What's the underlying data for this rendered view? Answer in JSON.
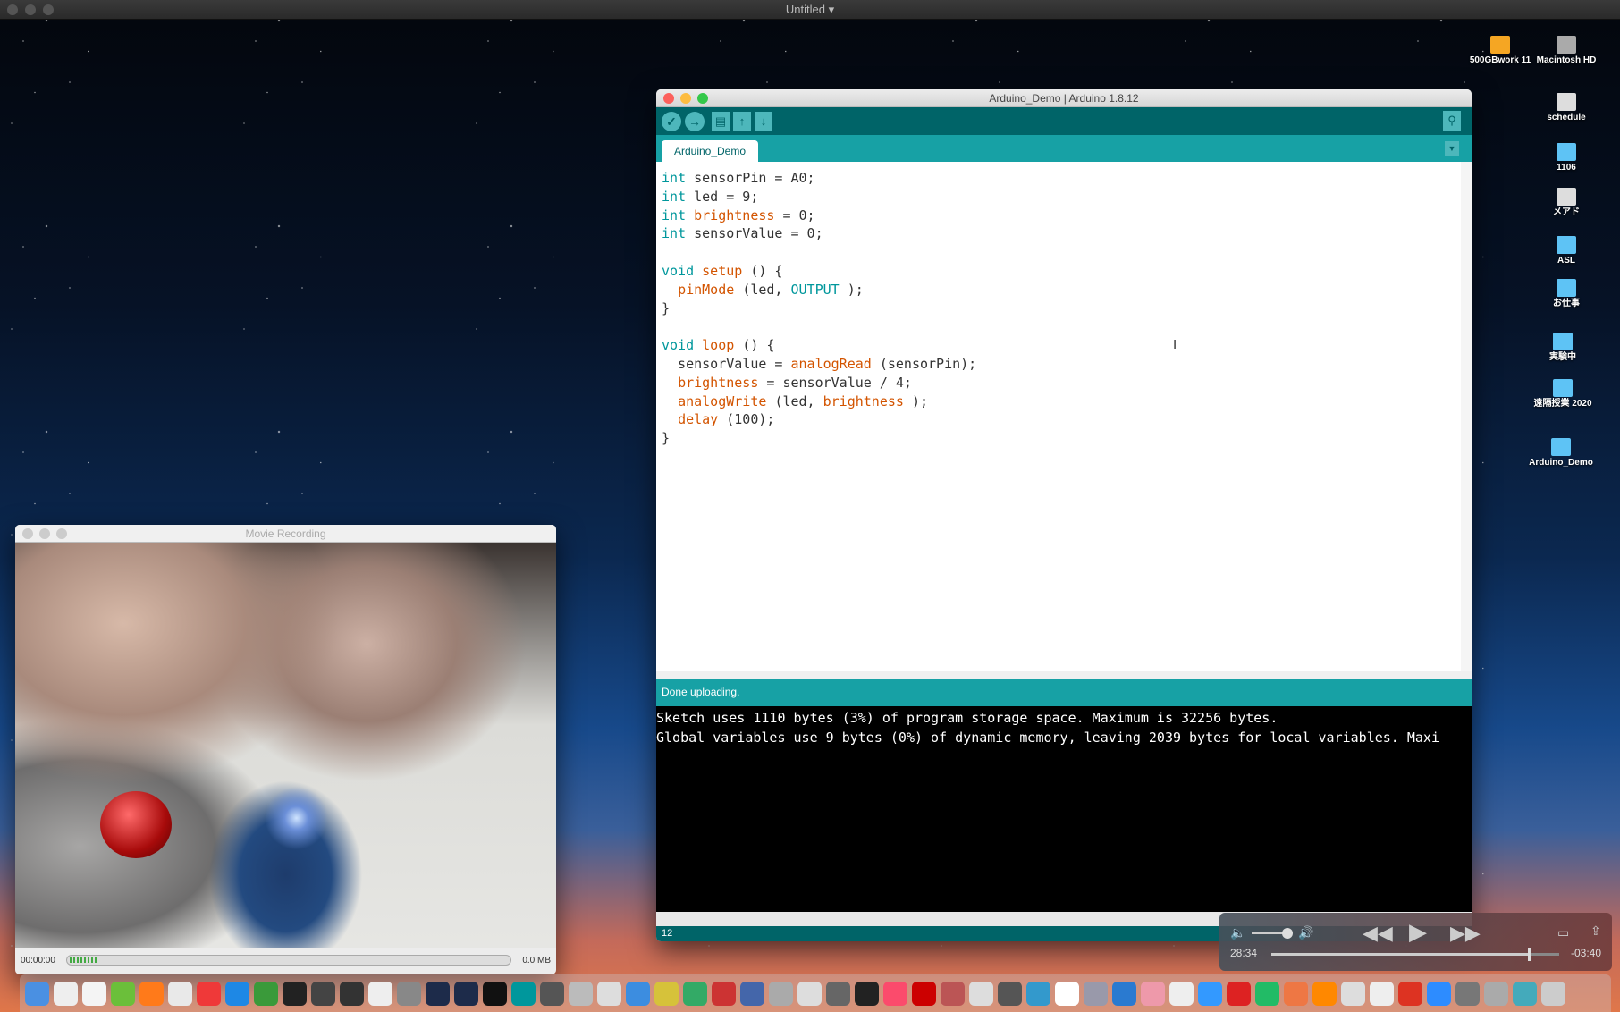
{
  "menubar": {
    "title": "Untitled"
  },
  "arduino": {
    "title": "Arduino_Demo | Arduino 1.8.12",
    "tab": "Arduino_Demo",
    "status": "Done uploading.",
    "line_number": "12",
    "code": [
      [
        [
          "kw",
          "int"
        ],
        [
          "",
          "sensorPin = A0;"
        ]
      ],
      [
        [
          "kw",
          "int"
        ],
        [
          "",
          "led = 9;"
        ]
      ],
      [
        [
          "kw",
          "int"
        ],
        [
          "fn",
          "brightness"
        ],
        [
          "",
          "= 0;"
        ]
      ],
      [
        [
          "kw",
          "int"
        ],
        [
          "",
          "sensorValue = 0;"
        ]
      ],
      [],
      [
        [
          "kw",
          "void"
        ],
        [
          "fn",
          "setup"
        ],
        [
          "",
          "() {"
        ]
      ],
      [
        [
          "",
          "  "
        ],
        [
          "fn",
          "pinMode"
        ],
        [
          "",
          "(led, "
        ],
        [
          "kw",
          "OUTPUT"
        ],
        [
          "",
          ");"
        ]
      ],
      [
        [
          "",
          "}"
        ]
      ],
      [],
      [
        [
          "kw",
          "void"
        ],
        [
          "fn",
          "loop"
        ],
        [
          "",
          "() {"
        ]
      ],
      [
        [
          "",
          "  sensorValue = "
        ],
        [
          "fn",
          "analogRead"
        ],
        [
          "",
          "(sensorPin);"
        ]
      ],
      [
        [
          "",
          "  "
        ],
        [
          "fn",
          "brightness"
        ],
        [
          "",
          "= sensorValue / 4;"
        ]
      ],
      [
        [
          "",
          "  "
        ],
        [
          "fn",
          "analogWrite"
        ],
        [
          "",
          "(led, "
        ],
        [
          "fn",
          "brightness"
        ],
        [
          "",
          ");"
        ]
      ],
      [
        [
          "",
          "  "
        ],
        [
          "fn",
          "delay"
        ],
        [
          "",
          "(100);"
        ]
      ],
      [
        [
          "",
          "}"
        ]
      ]
    ],
    "console": [
      "Sketch uses 1110 bytes (3%) of program storage space. Maximum is 32256 bytes.",
      "Global variables use 9 bytes (0%) of dynamic memory, leaving 2039 bytes for local variables. Maxi"
    ]
  },
  "movie": {
    "title": "Movie Recording",
    "time": "00:00:00",
    "size": "0.0 MB"
  },
  "player": {
    "elapsed": "28:34",
    "remaining": "-03:40",
    "progress": 0.89,
    "volume": 0.8
  },
  "desktop": {
    "icons": [
      {
        "label": "500GBwork 11",
        "color": "#f5a623"
      },
      {
        "label": "Macintosh HD",
        "color": "#aaa"
      },
      {
        "label": "schedule",
        "color": "#ddd"
      },
      {
        "label": "1106",
        "color": "#5ec3f5"
      },
      {
        "label": "メアド",
        "color": "#ddd"
      },
      {
        "label": "ASL",
        "color": "#5ec3f5"
      },
      {
        "label": "お仕事",
        "color": "#5ec3f5"
      },
      {
        "label": "実験中",
        "color": "#5ec3f5"
      },
      {
        "label": "遠隔授業 2020",
        "color": "#5ec3f5"
      },
      {
        "label": "Arduino_Demo",
        "color": "#5ec3f5"
      }
    ]
  },
  "dock": [
    "finder",
    "jedit",
    "textedit",
    "numbers",
    "firefox",
    "chrome",
    "vivaldi",
    "safari",
    "bbedit",
    "terminal",
    "app7",
    "app8",
    "puredata",
    "blender",
    "processing-p5",
    "processing",
    "p3",
    "arduino",
    "app-robot",
    "app-hat",
    "app-plane",
    "app-folder",
    "app-color",
    "app-prism",
    "app-tools",
    "app-pencil",
    "app-printer",
    "app-mail",
    "app-disk",
    "app-piano",
    "itunes",
    "flash",
    "guitar",
    "app-check",
    "app-globe",
    "app-net",
    "app-home",
    "app-mail2",
    "activity",
    "app-keys",
    "app-apr",
    "app-ring",
    "app-down",
    "app-q",
    "app-refresh",
    "vlc",
    "app-doc",
    "app-doc2",
    "gmail",
    "zoom",
    "sysprefs",
    "app-dl",
    "app-folder2",
    "trash"
  ]
}
